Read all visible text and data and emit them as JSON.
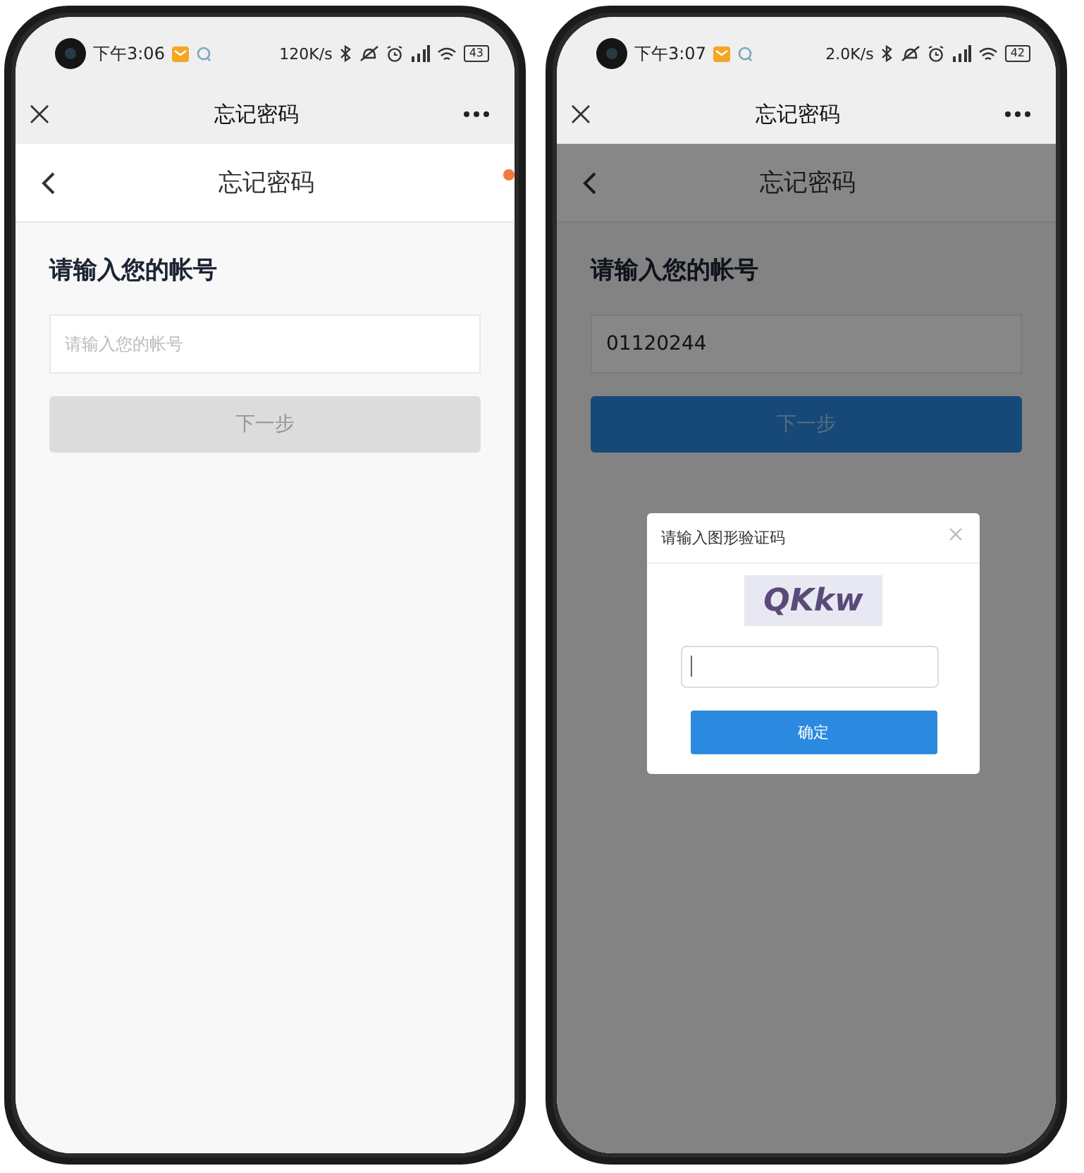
{
  "phones": [
    {
      "status_bar": {
        "time": "下午3:06",
        "speed": "120K/s",
        "battery": "43"
      },
      "app_bar": {
        "title": "忘记密码"
      },
      "page": {
        "title": "忘记密码",
        "notification_dot": true,
        "heading": "请输入您的帐号",
        "account_field": {
          "placeholder": "请输入您的帐号"
        },
        "next_button": {
          "label": "下一步",
          "disabled": true
        }
      }
    },
    {
      "status_bar": {
        "time": "下午3:07",
        "speed": "2.0K/s",
        "battery": "42"
      },
      "app_bar": {
        "title": "忘记密码"
      },
      "page": {
        "title": "忘记密码",
        "heading": "请输入您的帐号",
        "account_field": {
          "value": "01120244"
        },
        "next_button": {
          "label": "下一步",
          "disabled": false
        }
      },
      "dialog": {
        "title": "请输入图形验证码",
        "captcha_text": "QKkw",
        "code_field": {
          "focused": true
        },
        "confirm_button": {
          "label": "确定"
        }
      }
    }
  ]
}
